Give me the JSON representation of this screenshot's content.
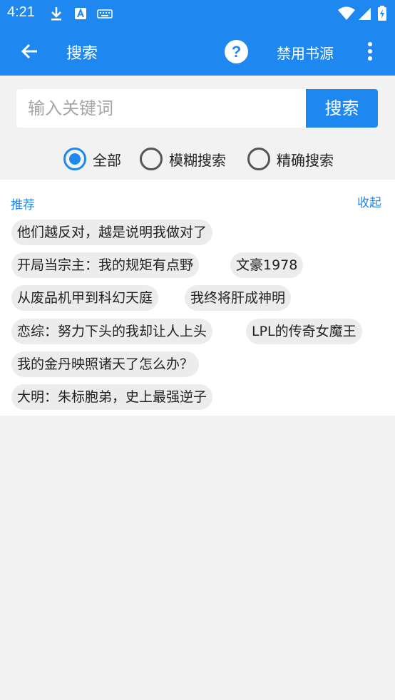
{
  "status_bar": {
    "time": "4:21",
    "icons": [
      "download-icon",
      "a-box-icon",
      "keyboard-icon",
      "wifi-icon",
      "signal-icon",
      "battery-icon"
    ]
  },
  "app_bar": {
    "title": "搜索",
    "help_label": "?",
    "disable_source_label": "禁用书源"
  },
  "search": {
    "placeholder": "输入关键词",
    "value": "",
    "button_label": "搜索"
  },
  "search_modes": [
    {
      "label": "全部",
      "checked": true
    },
    {
      "label": "模糊搜索",
      "checked": false
    },
    {
      "label": "精确搜索",
      "checked": false
    }
  ],
  "recommend": {
    "title": "推荐",
    "collapse_label": "收起",
    "items": [
      "他们越反对，越是说明我做对了",
      "开局当宗主：我的规矩有点野",
      "文豪1978",
      "从废品机甲到科幻天庭",
      "我终将肝成神明",
      "恋综：努力下头的我却让人上头",
      "LPL的传奇女魔王",
      "我的金丹映照诸天了怎么办？",
      "大明：朱标胞弟，史上最强逆子"
    ]
  },
  "colors": {
    "accent": "#1e88f0",
    "background": "#f2f2f2",
    "chip": "#ececec"
  }
}
